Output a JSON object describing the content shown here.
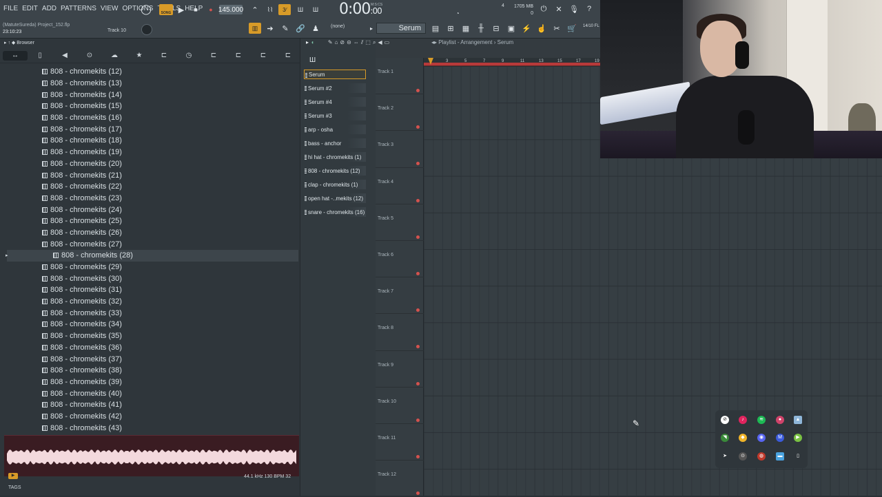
{
  "menu": [
    "FILE",
    "EDIT",
    "ADD",
    "PATTERNS",
    "VIEW",
    "OPTIONS",
    "TOOLS",
    "HELP"
  ],
  "project": {
    "user": "(MatuteSureda)",
    "file": "Project_152.flp",
    "time": "23:10:23",
    "track": "Track 10"
  },
  "transport": {
    "song_label": "SONG",
    "tempo": "145.000",
    "clock_main": "0:00",
    "clock_frac": ":00",
    "clock_unit": "M:S:CS"
  },
  "stats": {
    "cpu": "4",
    "mem": "1705 MB",
    "voices": "0"
  },
  "toolbar": {
    "pattern": "(none)",
    "instrument": "Serum",
    "fl_studio": "14/10\nFL Studi"
  },
  "browser": {
    "title": "Browser",
    "files": [
      "808 - chromekits (12)",
      "808 - chromekits (13)",
      "808 - chromekits (14)",
      "808 - chromekits (15)",
      "808 - chromekits (16)",
      "808 - chromekits (17)",
      "808 - chromekits (18)",
      "808 - chromekits (19)",
      "808 - chromekits (20)",
      "808 - chromekits (21)",
      "808 - chromekits (22)",
      "808 - chromekits (23)",
      "808 - chromekits (24)",
      "808 - chromekits (25)",
      "808 - chromekits (26)",
      "808 - chromekits (27)",
      "808 - chromekits (28)",
      "808 - chromekits (29)",
      "808 - chromekits (30)",
      "808 - chromekits (31)",
      "808 - chromekits (32)",
      "808 - chromekits (33)",
      "808 - chromekits (34)",
      "808 - chromekits (35)",
      "808 - chromekits (36)",
      "808 - chromekits (37)",
      "808 - chromekits (38)",
      "808 - chromekits (39)",
      "808 - chromekits (40)",
      "808 - chromekits (41)",
      "808 - chromekits (42)",
      "808 - chromekits (43)"
    ],
    "selected_index": 16,
    "wave_info": "44.1 kHz 130 BPM 32",
    "tags_label": "TAGS"
  },
  "channels": [
    "Serum",
    "Serum #2",
    "Serum #4",
    "Serum #3",
    "arp - osha",
    "bass - anchor",
    "hi hat - chromekits (1)",
    "808 - chromekits (12)",
    "clap - chromekits (1)",
    "open hat -..mekits (12)",
    "snare - chromekits (16)"
  ],
  "playlist": {
    "title": "Playlist - Arrangement",
    "pattern": "Serum",
    "ruler": [
      "3",
      "5",
      "7",
      "9",
      "11",
      "13",
      "15",
      "17",
      "19"
    ],
    "tracks": [
      "Track 1",
      "Track 2",
      "Track 3",
      "Track 4",
      "Track 5",
      "Track 6",
      "Track 7",
      "Track 8",
      "Track 9",
      "Track 10",
      "Track 11",
      "Track 12"
    ]
  },
  "colors": {
    "accent": "#d89b28",
    "record": "#d4524e",
    "bg": "#343b40"
  }
}
